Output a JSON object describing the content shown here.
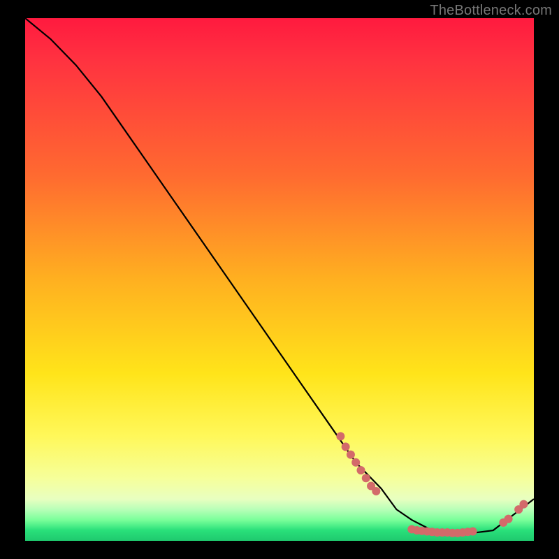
{
  "watermark": "TheBottleneck.com",
  "chart_data": {
    "type": "line",
    "title": "",
    "xlabel": "",
    "ylabel": "",
    "xlim": [
      0,
      100
    ],
    "ylim": [
      0,
      100
    ],
    "grid": false,
    "legend": false,
    "background_gradient": {
      "top": "#ff1a3f",
      "mid_upper": "#ff6a30",
      "mid": "#ffe41a",
      "mid_lower": "#f6ff9a",
      "bottom": "#1fc96e"
    },
    "series": [
      {
        "name": "bottleneck-curve",
        "color": "#000000",
        "x": [
          0,
          5,
          10,
          15,
          20,
          25,
          30,
          35,
          40,
          45,
          50,
          55,
          60,
          65,
          70,
          73,
          76,
          80,
          84,
          88,
          92,
          96,
          100
        ],
        "y": [
          100,
          96,
          91,
          85,
          78,
          71,
          64,
          57,
          50,
          43,
          36,
          29,
          22,
          15,
          10,
          6,
          4,
          2,
          1.5,
          1.5,
          2,
          5,
          8
        ]
      }
    ],
    "points": [
      {
        "name": "cluster-descend-1",
        "x": 62,
        "y": 20
      },
      {
        "name": "cluster-descend-2",
        "x": 63,
        "y": 18
      },
      {
        "name": "cluster-descend-3",
        "x": 64,
        "y": 16.5
      },
      {
        "name": "cluster-descend-4",
        "x": 65,
        "y": 15
      },
      {
        "name": "cluster-descend-5",
        "x": 66,
        "y": 13.5
      },
      {
        "name": "cluster-descend-6",
        "x": 67,
        "y": 12
      },
      {
        "name": "cluster-descend-7",
        "x": 68,
        "y": 10.5
      },
      {
        "name": "cluster-descend-8",
        "x": 69,
        "y": 9.5
      },
      {
        "name": "trough-1",
        "x": 76,
        "y": 2.2
      },
      {
        "name": "trough-2",
        "x": 77,
        "y": 2.0
      },
      {
        "name": "trough-3",
        "x": 78,
        "y": 1.9
      },
      {
        "name": "trough-4",
        "x": 79,
        "y": 1.8
      },
      {
        "name": "trough-5",
        "x": 80,
        "y": 1.7
      },
      {
        "name": "trough-6",
        "x": 81,
        "y": 1.6
      },
      {
        "name": "trough-7",
        "x": 82,
        "y": 1.6
      },
      {
        "name": "trough-8",
        "x": 83,
        "y": 1.6
      },
      {
        "name": "trough-9",
        "x": 84,
        "y": 1.5
      },
      {
        "name": "trough-10",
        "x": 85,
        "y": 1.5
      },
      {
        "name": "trough-11",
        "x": 86,
        "y": 1.6
      },
      {
        "name": "trough-12",
        "x": 87,
        "y": 1.7
      },
      {
        "name": "trough-13",
        "x": 88,
        "y": 1.8
      },
      {
        "name": "rise-1",
        "x": 94,
        "y": 3.5
      },
      {
        "name": "rise-2",
        "x": 95,
        "y": 4.2
      },
      {
        "name": "rise-3",
        "x": 97,
        "y": 6.0
      },
      {
        "name": "rise-4",
        "x": 98,
        "y": 7.0
      }
    ],
    "point_color": "#d36a6a",
    "point_radius_px": 6
  }
}
